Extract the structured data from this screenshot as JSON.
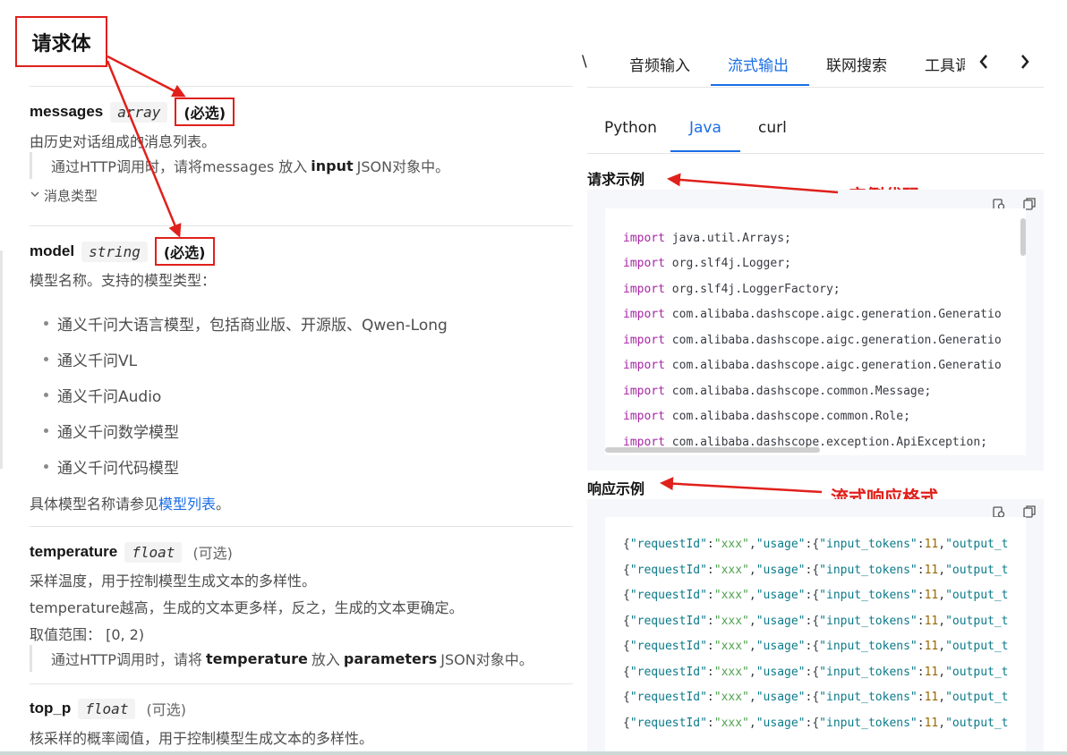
{
  "left": {
    "section_title": "请求体",
    "params": [
      {
        "name": "messages",
        "type": "array",
        "required_label": "(必选)",
        "desc": "由历史对话组成的消息列表。",
        "note_pre": "通过HTTP调用时，请将messages 放入",
        "note_bold": "input",
        "note_post": "JSON对象中。",
        "expander": "消息类型"
      },
      {
        "name": "model",
        "type": "string",
        "required_label": "(必选)",
        "desc": "模型名称。支持的模型类型：",
        "bullets": [
          "通义千问大语言模型，包括商业版、开源版、Qwen-Long",
          "通义千问VL",
          "通义千问Audio",
          "通义千问数学模型",
          "通义千问代码模型"
        ],
        "footer_pre": "具体模型名称请参见",
        "footer_link": "模型列表",
        "footer_post": "。"
      },
      {
        "name": "temperature",
        "type": "float",
        "optional_label": "(可选)",
        "desc1": "采样温度，用于控制模型生成文本的多样性。",
        "desc2": "temperature越高，生成的文本更多样，反之，生成的文本更确定。",
        "range": "取值范围：  [0, 2)",
        "note_pre": "通过HTTP调用时，请将",
        "note_bold1": "temperature",
        "note_mid": "放入",
        "note_bold2": "parameters",
        "note_post": "JSON对象中。"
      },
      {
        "name": "top_p",
        "type": "float",
        "optional_label": "(可选)",
        "desc": "核采样的概率阈值，用于控制模型生成文本的多样性。"
      }
    ]
  },
  "right": {
    "top_tabs": [
      "\\",
      "音频输入",
      "流式输出",
      "联网搜索",
      "工具调"
    ],
    "top_tab_active": "流式输出",
    "lang_tabs": [
      "Python",
      "Java",
      "curl"
    ],
    "lang_active": "Java",
    "request_label": "请求示例",
    "response_label": "响应示例",
    "annotation_code": "实例代码",
    "annotation_stream": "流式响应格式",
    "java_imports": [
      "java.util.Arrays;",
      "org.slf4j.Logger;",
      "org.slf4j.LoggerFactory;",
      "com.alibaba.dashscope.aigc.generation.Generatio",
      "com.alibaba.dashscope.aigc.generation.Generatio",
      "com.alibaba.dashscope.aigc.generation.Generatio",
      "com.alibaba.dashscope.common.Message;",
      "com.alibaba.dashscope.common.Role;",
      "com.alibaba.dashscope.exception.ApiException;"
    ],
    "import_keyword": "import",
    "response_line": {
      "k1": "\"requestId\"",
      "v1": "\"xxx\"",
      "k2": "\"usage\"",
      "k3": "\"input_tokens\"",
      "v3": "11",
      "k4": "\"output_t"
    },
    "response_count": 8
  },
  "icons": [
    "copy-icon",
    "duplicate-icon",
    "chevron-left-icon",
    "chevron-right-icon",
    "chevron-down-icon"
  ],
  "colors": {
    "accent": "#1a6ee6",
    "annotation": "#e0201b",
    "keyword": "#a626a4"
  }
}
